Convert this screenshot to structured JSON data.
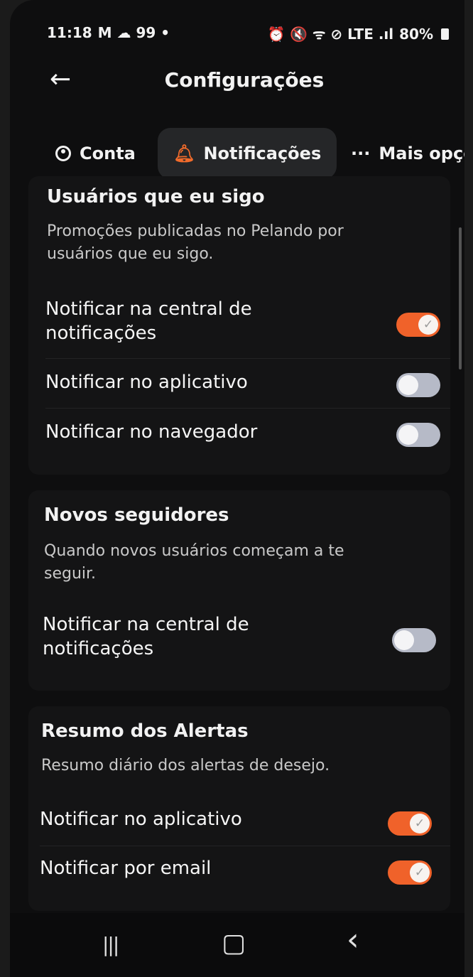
{
  "status_bar": {
    "time": "11:18",
    "left_icons": "M ☁ 99 •",
    "right_icons": "⏰ 🔇 ᯤ ⊘ LTE .ıl",
    "battery": "80%"
  },
  "header": {
    "title": "Configurações"
  },
  "tabs": [
    {
      "label": "Conta",
      "icon": "user-circle-icon"
    },
    {
      "label": "Notificações",
      "icon": "bell-icon",
      "active": true
    },
    {
      "label": "Mais opçõ",
      "icon": "more-dots-icon"
    }
  ],
  "sections": [
    {
      "title": "Usuários que eu sigo",
      "description": "Promoções publicadas no Pelando por usuários que eu sigo.",
      "rows": [
        {
          "label": "Notificar na central de notificações",
          "on": true
        },
        {
          "label": "Notificar no aplicativo",
          "on": false
        },
        {
          "label": "Notificar no navegador",
          "on": false
        }
      ]
    },
    {
      "title": "Novos seguidores",
      "description": "Quando novos usuários começam a te seguir.",
      "rows": [
        {
          "label": "Notificar na central de notificações",
          "on": false
        }
      ]
    },
    {
      "title": "Resumo dos Alertas",
      "description": "Resumo diário dos alertas de desejo.",
      "rows": [
        {
          "label": "Notificar no aplicativo",
          "on": true
        },
        {
          "label": "Notificar por email",
          "on": true
        }
      ]
    }
  ],
  "nav": {
    "recents": "|||",
    "home": "▢",
    "back": "‹"
  },
  "colors": {
    "accent": "#f0622a",
    "background": "#0e0e0f"
  }
}
